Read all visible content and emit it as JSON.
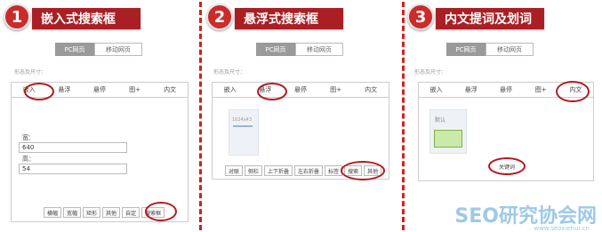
{
  "steps": [
    {
      "num": "1",
      "title": "嵌入式搜索框",
      "tabs": [
        "PC网页",
        "移动网页"
      ],
      "size_label": "形态及尺寸：",
      "panel_tabs": [
        "嵌入",
        "悬浮",
        "悬停",
        "图+",
        "内文"
      ],
      "width_label": "宽：",
      "width_value": "640",
      "height_label": "高：",
      "height_value": "54",
      "buttons": [
        "横幅",
        "宽幅",
        "矩形",
        "其他",
        "自定",
        "搜索框"
      ]
    },
    {
      "num": "2",
      "title": "悬浮式搜索框",
      "tabs": [
        "PC网页",
        "移动网页"
      ],
      "size_label": "形态及尺寸：",
      "panel_tabs": [
        "嵌入",
        "悬浮",
        "悬停",
        "图+",
        "内文"
      ],
      "preview_text": "1024x43",
      "buttons": [
        "对联",
        "侧栏",
        "上下折叠",
        "左右折叠",
        "标签",
        "搜索",
        "其他"
      ]
    },
    {
      "num": "3",
      "title": "内文提词及划词",
      "tabs": [
        "PC网页",
        "移动网页"
      ],
      "size_label": "形态及尺寸：",
      "panel_tabs": [
        "嵌入",
        "悬浮",
        "悬停",
        "图+",
        "内文"
      ],
      "preview_text": "默认",
      "keyword_btn": "关键词"
    }
  ],
  "watermark": {
    "text": "SEO研究协会网",
    "url": "www.seoxiehui.cn"
  },
  "colors": {
    "accent": "#a91f24",
    "badge": "#cc2b2b",
    "dash": "#d21f1f"
  }
}
